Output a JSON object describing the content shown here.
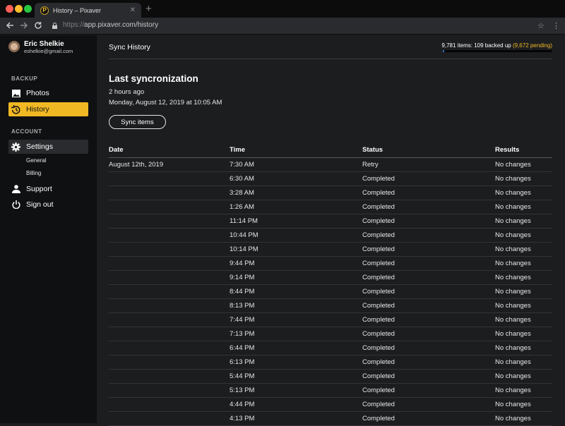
{
  "browser": {
    "tab_title": "History – Pixaver",
    "tab_favicon": "P",
    "url_scheme": "https://",
    "url_rest": "app.pixaver.com/history"
  },
  "sidebar": {
    "user": {
      "name": "Eric Shelkie",
      "email": "eshelkie@gmail.com"
    },
    "backup_label": "BACKUP",
    "account_label": "ACCOUNT",
    "items": {
      "photos": "Photos",
      "history": "History",
      "settings": "Settings",
      "general": "General",
      "billing": "Billing",
      "support": "Support",
      "signout": "Sign out"
    }
  },
  "header": {
    "title": "Sync History",
    "status_prefix": "9,781 items: 109 backed up",
    "status_pending": "(9,672 pending)",
    "progress_fraction": 0.011
  },
  "sync": {
    "heading": "Last syncronization",
    "ago": "2 hours ago",
    "date": "Monday, August 12, 2019 at 10:05 AM",
    "button": "Sync items"
  },
  "table": {
    "headers": [
      "Date",
      "Time",
      "Status",
      "Results"
    ],
    "rows": [
      [
        "August 12th, 2019",
        "7:30 AM",
        "Retry",
        "No changes"
      ],
      [
        "",
        "6:30 AM",
        "Completed",
        "No changes"
      ],
      [
        "",
        "3:28 AM",
        "Completed",
        "No changes"
      ],
      [
        "",
        "1:26 AM",
        "Completed",
        "No changes"
      ],
      [
        "",
        "11:14 PM",
        "Completed",
        "No changes"
      ],
      [
        "",
        "10:44 PM",
        "Completed",
        "No changes"
      ],
      [
        "",
        "10:14 PM",
        "Completed",
        "No changes"
      ],
      [
        "",
        "9:44 PM",
        "Completed",
        "No changes"
      ],
      [
        "",
        "9:14 PM",
        "Completed",
        "No changes"
      ],
      [
        "",
        "8:44 PM",
        "Completed",
        "No changes"
      ],
      [
        "",
        "8:13 PM",
        "Completed",
        "No changes"
      ],
      [
        "",
        "7:44 PM",
        "Completed",
        "No changes"
      ],
      [
        "",
        "7:13 PM",
        "Completed",
        "No changes"
      ],
      [
        "",
        "6:44 PM",
        "Completed",
        "No changes"
      ],
      [
        "",
        "6:13 PM",
        "Completed",
        "No changes"
      ],
      [
        "",
        "5:44 PM",
        "Completed",
        "No changes"
      ],
      [
        "",
        "5:13 PM",
        "Completed",
        "No changes"
      ],
      [
        "",
        "4:44 PM",
        "Completed",
        "No changes"
      ],
      [
        "",
        "4:13 PM",
        "Completed",
        "No changes"
      ]
    ]
  },
  "colors": {
    "accent": "#f0b823",
    "sidebar_bg": "#0f1011",
    "main_bg": "#1c1d1f",
    "progress": "#3a7bd5"
  },
  "icons": [
    "photo-icon",
    "history-icon",
    "gear-icon",
    "person-icon",
    "power-icon",
    "lock-icon",
    "star-icon",
    "menu-icon"
  ]
}
